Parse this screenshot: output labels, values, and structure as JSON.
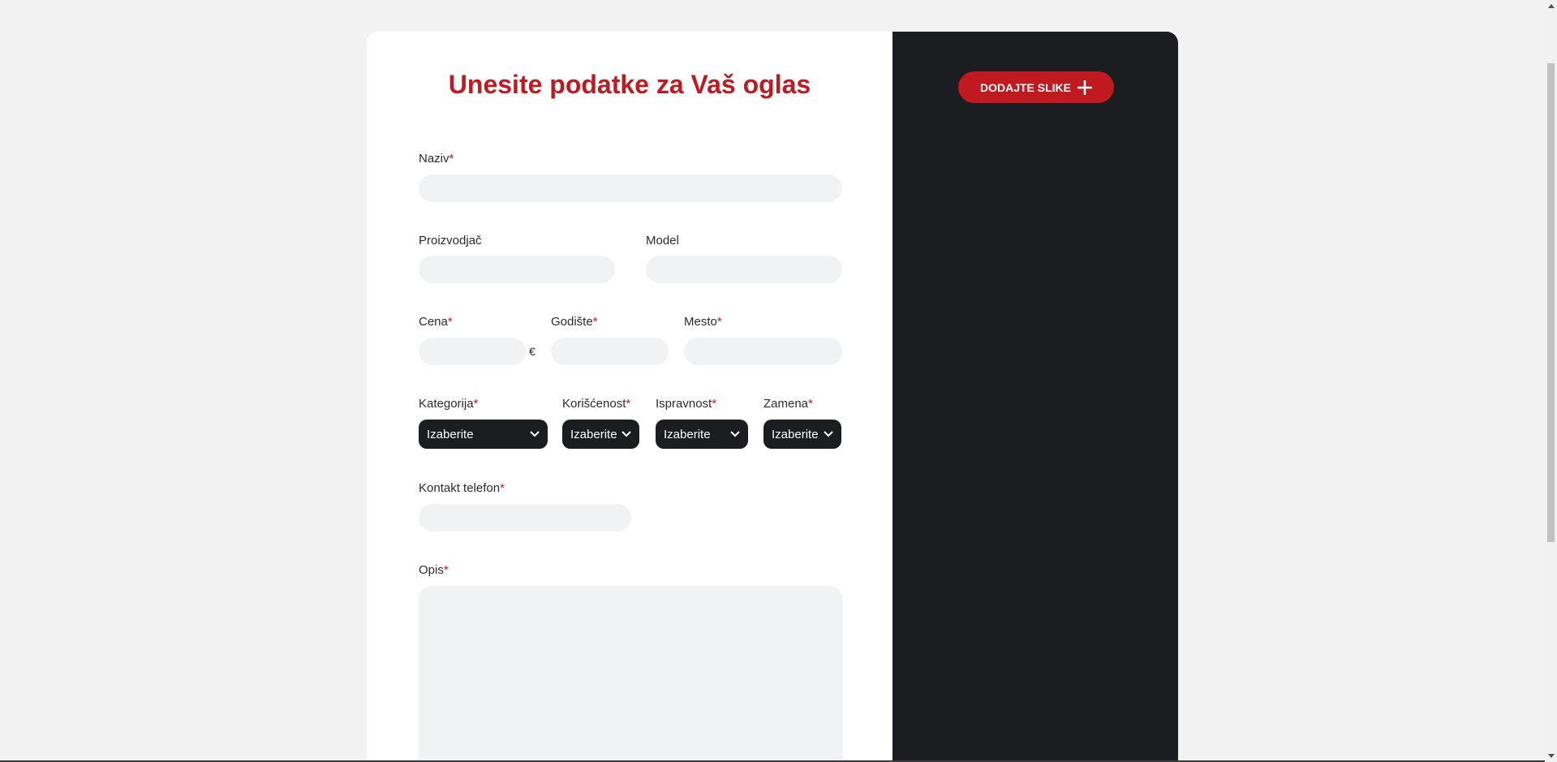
{
  "form": {
    "title": "Unesite podatke za Vaš oglas",
    "required_mark": "*",
    "fields": {
      "naziv": {
        "label": "Naziv",
        "value": ""
      },
      "proizvodjac": {
        "label": "Proizvodjač",
        "value": ""
      },
      "model": {
        "label": "Model",
        "value": ""
      },
      "cena": {
        "label": "Cena",
        "value": "",
        "currency": "€"
      },
      "godiste": {
        "label": "Godište",
        "value": ""
      },
      "mesto": {
        "label": "Mesto",
        "value": ""
      },
      "kategorija": {
        "label": "Kategorija",
        "selected": "Izaberite"
      },
      "koriscenost": {
        "label": "Korišćenost",
        "selected": "Izaberite"
      },
      "ispravnost": {
        "label": "Ispravnost",
        "selected": "Izaberite"
      },
      "zamena": {
        "label": "Zamena",
        "selected": "Izaberite"
      },
      "kontakt_telefon": {
        "label": "Kontakt telefon",
        "value": ""
      },
      "opis": {
        "label": "Opis",
        "value": ""
      }
    }
  },
  "images_panel": {
    "add_button_label": "DODAJTE SLIKE",
    "add_button_icon": "plus-icon"
  },
  "colors": {
    "accent": "#c0191f",
    "dark_panel": "#1b1d20",
    "input_bg": "#f1f2f4",
    "page_bg": "#f2f2f2"
  }
}
